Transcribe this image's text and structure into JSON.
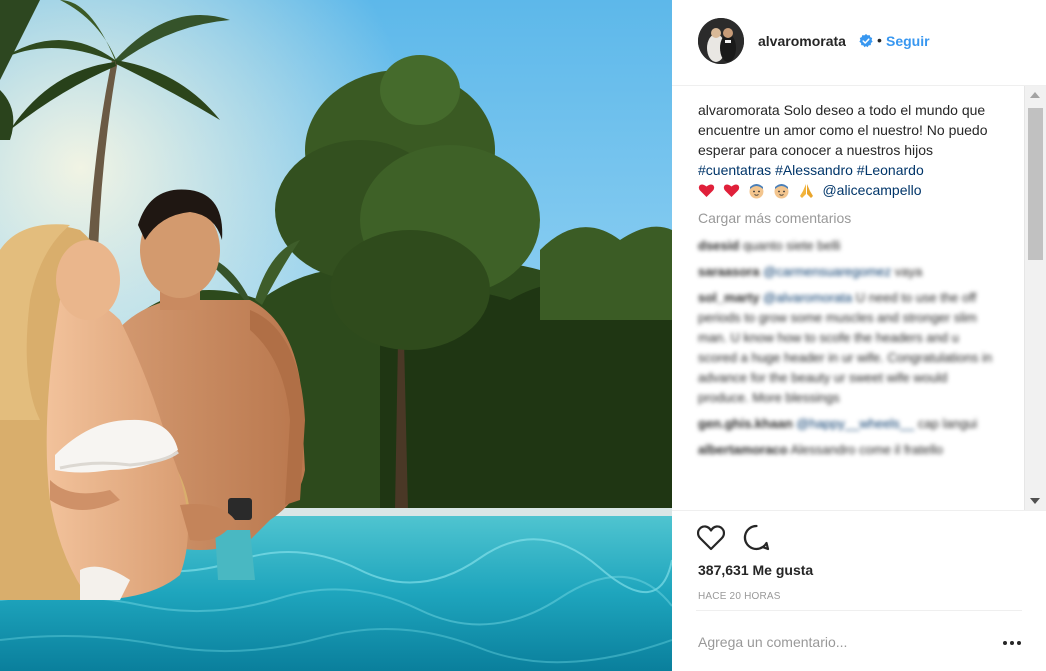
{
  "post": {
    "username": "alvaromorata",
    "follow_label": "Seguir",
    "dot": "•"
  },
  "caption": {
    "username": "alvaromorata",
    "text": "Solo deseo a todo el mundo que encuentre un amor como el nuestro! No puedo esperar para conocer a nuestros hijos",
    "hashtags": [
      "#cuentatras",
      "#Alessandro",
      "#Leonardo"
    ],
    "emojis": [
      "red-heart",
      "red-heart",
      "baby-face",
      "baby-face",
      "folded-hands"
    ],
    "mention": "@alicecampello"
  },
  "load_more_label": "Cargar más comentarios",
  "blurred_comments": [
    {
      "user": "dsesid",
      "text": "quanto siete belli"
    },
    {
      "user": "saraasora",
      "link": "@carmensuaregomez",
      "text": "vaya"
    },
    {
      "user": "sol_marty",
      "link": "@alvaromorata",
      "text": "U need to use the off periods to grow some muscles and stronger slim man. U know how to scofe the headers and u scored a huge header in ur wife. Congratulations in advance for the beauty ur sweet wife would produce. More blessings"
    },
    {
      "user": "gen.ghis.khaan",
      "link": "@happy__wheels__",
      "text": "cap langui"
    },
    {
      "user": "albertamoraco",
      "text": "Alessandro come il fratello"
    }
  ],
  "likes": "387,631 Me gusta",
  "timestamp": "HACE 20 HORAS",
  "comment_input": {
    "placeholder": "Agrega un comentario..."
  },
  "colors": {
    "link_blue": "#3897f0",
    "hashtag_blue": "#003569",
    "muted_gray": "#999999",
    "verified_blue": "#3897f0"
  },
  "icons": {
    "verified": "verified-badge-icon",
    "like": "heart-icon",
    "comment": "comment-bubble-icon",
    "more": "more-options-icon"
  }
}
